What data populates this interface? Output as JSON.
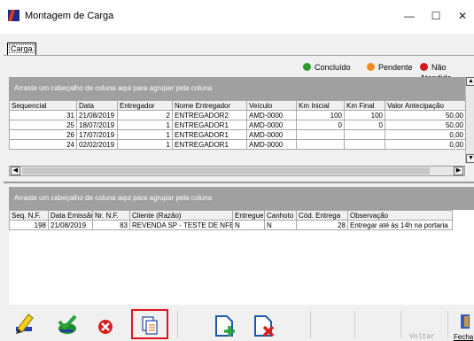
{
  "window": {
    "title": "Montagem de Carga",
    "minimize": "—",
    "maximize": "☐",
    "close": "✕"
  },
  "tab": {
    "label": "Carga"
  },
  "legend": [
    {
      "label": "Concluído",
      "color": "#2e9a2e"
    },
    {
      "label": "Pendente",
      "color": "#f08a1c"
    },
    {
      "label": "Não Atendido",
      "color": "#d8161b"
    }
  ],
  "grid1": {
    "group_hint": "Arraste um cabeçalho de coluna aqui para agrupar pela coluna",
    "columns": [
      "Sequencial",
      "Data",
      "Entregador",
      "Nome Entregador",
      "Veículo",
      "Km Inicial",
      "Km Final",
      "Valor Antecipação"
    ],
    "rows": [
      [
        "31",
        "21/08/2019",
        "2",
        "ENTREGADOR2",
        "AMD-0000",
        "100",
        "100",
        "50,00"
      ],
      [
        "25",
        "18/07/2019",
        "1",
        "ENTREGADOR1",
        "AMD-0000",
        "0",
        "0",
        "50,00"
      ],
      [
        "26",
        "17/07/2019",
        "1",
        "ENTREGADOR1",
        "AMD-0000",
        "",
        "",
        "0,00"
      ],
      [
        "24",
        "02/02/2019",
        "1",
        "ENTREGADOR1",
        "AMD-0000",
        "",
        "",
        "0,00"
      ]
    ]
  },
  "grid2": {
    "group_hint": "Arraste um cabeçalho de coluna aqui para agrupar pela coluna",
    "columns": [
      "Seq. N.F.",
      "Data Emissão",
      "Nr. N.F.",
      "Cliente (Razão)",
      "Entregue",
      "Canhoto",
      "Cód. Entrega",
      "Observação"
    ],
    "rows": [
      [
        "198",
        "21/08/2019",
        "83",
        "REVENDA SP - TESTE DE NFE",
        "N",
        "N",
        "28",
        "Entregar até às 14h na portaria"
      ]
    ]
  },
  "toolbar": {
    "buttons": [
      {
        "icon": "edit-pencil-icon"
      },
      {
        "icon": "confirm-check-icon"
      },
      {
        "icon": "cancel-x-icon"
      },
      {
        "icon": "copy-document-icon"
      },
      {
        "icon": "add-document-icon"
      },
      {
        "icon": "remove-document-icon"
      }
    ],
    "voltar_label": "Voltar",
    "fechar_label": "Fecha"
  }
}
